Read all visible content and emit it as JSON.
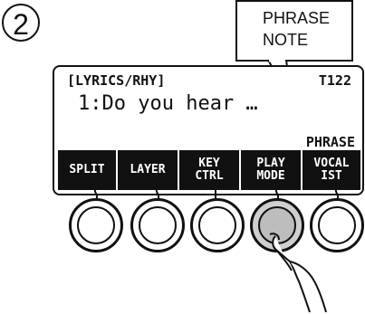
{
  "step": {
    "number": "2"
  },
  "callout": {
    "line1": "PHRASE",
    "line2": "NOTE"
  },
  "lcd": {
    "mode_label": "[LYRICS/RHY]",
    "tempo": "T122",
    "lyric_line": "1:Do you hear …",
    "phrase_indicator": "PHRASE",
    "softkeys": [
      {
        "line1": "SPLIT",
        "line2": ""
      },
      {
        "line1": "LAYER",
        "line2": ""
      },
      {
        "line1": "KEY",
        "line2": "CTRL"
      },
      {
        "line1": "PLAY",
        "line2": "MODE"
      },
      {
        "line1": "VOCAL",
        "line2": "IST"
      }
    ]
  },
  "knobs": {
    "pressed_index": 3,
    "count": 5
  }
}
